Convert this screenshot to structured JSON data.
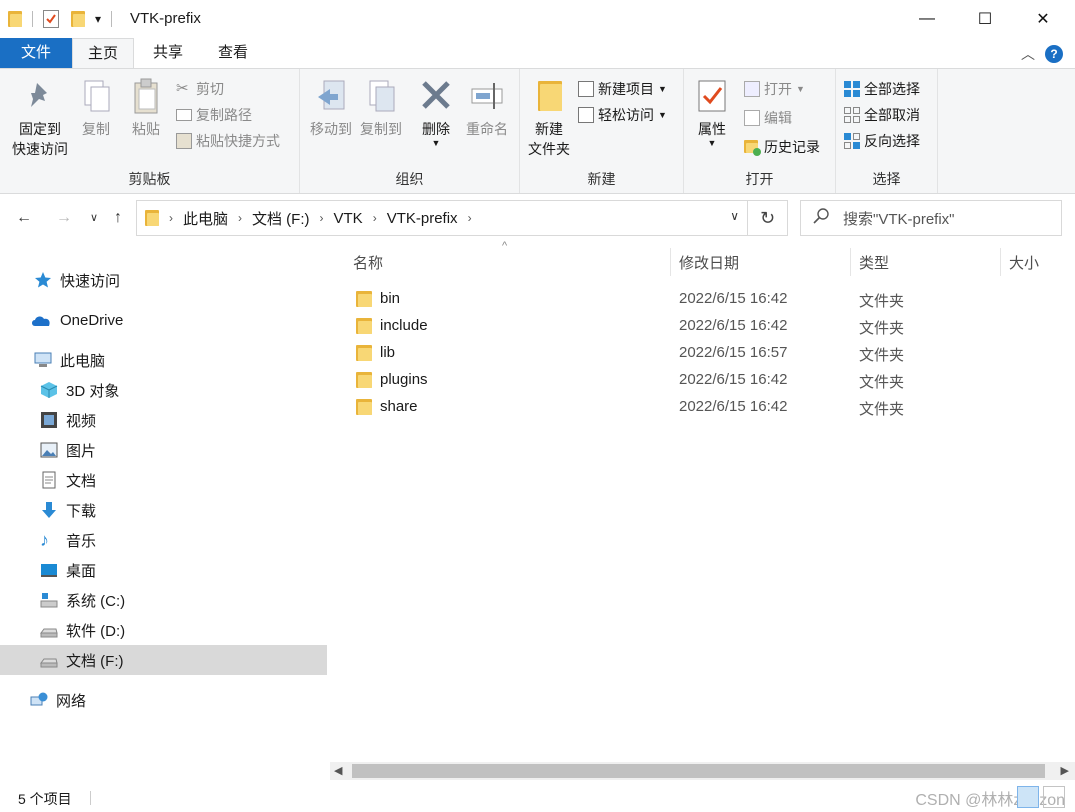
{
  "window": {
    "title": "VTK-prefix",
    "qat_dropdown": "▾",
    "minimize": "—",
    "maximize": "☐",
    "close": "✕"
  },
  "tabs": {
    "file": "文件",
    "home": "主页",
    "share": "共享",
    "view": "查看",
    "collapse": "︿",
    "help": "?"
  },
  "ribbon": {
    "clipboard": {
      "pin_line1": "固定到",
      "pin_line2": "快速访问",
      "copy": "复制",
      "paste": "粘贴",
      "cut": "剪切",
      "copy_path": "复制路径",
      "paste_shortcut": "粘贴快捷方式",
      "label": "剪贴板"
    },
    "organize": {
      "move_to": "移动到",
      "copy_to": "复制到",
      "delete": "删除",
      "rename": "重命名",
      "label": "组织"
    },
    "new": {
      "new_folder_line1": "新建",
      "new_folder_line2": "文件夹",
      "new_item": "新建项目",
      "easy_access": "轻松访问",
      "label": "新建"
    },
    "open": {
      "properties": "属性",
      "open": "打开",
      "edit": "编辑",
      "history": "历史记录",
      "label": "打开"
    },
    "select": {
      "select_all": "全部选择",
      "select_none": "全部取消",
      "invert": "反向选择",
      "label": "选择"
    }
  },
  "address": {
    "breadcrumbs": [
      "此电脑",
      "文档 (F:)",
      "VTK",
      "VTK-prefix"
    ],
    "search_placeholder": "搜索\"VTK-prefix\""
  },
  "navpane": {
    "items": [
      {
        "label": "快速访问",
        "icon": "star-icon"
      },
      {
        "label": "OneDrive",
        "icon": "cloud-icon"
      },
      {
        "label": "此电脑",
        "icon": "computer-icon"
      },
      {
        "label": "3D 对象",
        "icon": "cube-icon"
      },
      {
        "label": "视频",
        "icon": "video-icon"
      },
      {
        "label": "图片",
        "icon": "picture-icon"
      },
      {
        "label": "文档",
        "icon": "document-icon"
      },
      {
        "label": "下载",
        "icon": "download-icon"
      },
      {
        "label": "音乐",
        "icon": "music-icon"
      },
      {
        "label": "桌面",
        "icon": "desktop-icon"
      },
      {
        "label": "系统 (C:)",
        "icon": "system-drive-icon"
      },
      {
        "label": "软件 (D:)",
        "icon": "drive-icon"
      },
      {
        "label": "文档 (F:)",
        "icon": "drive-icon",
        "selected": true
      },
      {
        "label": "网络",
        "icon": "network-icon"
      }
    ]
  },
  "content": {
    "columns": {
      "name": "名称",
      "modified": "修改日期",
      "type": "类型",
      "size": "大小"
    },
    "sort_indicator": "^",
    "files": [
      {
        "name": "bin",
        "modified": "2022/6/15 16:42",
        "type": "文件夹"
      },
      {
        "name": "include",
        "modified": "2022/6/15 16:42",
        "type": "文件夹"
      },
      {
        "name": "lib",
        "modified": "2022/6/15 16:57",
        "type": "文件夹"
      },
      {
        "name": "plugins",
        "modified": "2022/6/15 16:42",
        "type": "文件夹"
      },
      {
        "name": "share",
        "modified": "2022/6/15 16:42",
        "type": "文件夹"
      }
    ]
  },
  "status": {
    "item_count": "5 个项目",
    "watermark": "CSDN @林林zonzon"
  },
  "colors": {
    "accent": "#1a6fc4",
    "folder_front": "#f8d775",
    "folder_back": "#e9b43a",
    "ribbon_bg": "#f5f6f7",
    "selected_bg": "#d9d9d9"
  }
}
